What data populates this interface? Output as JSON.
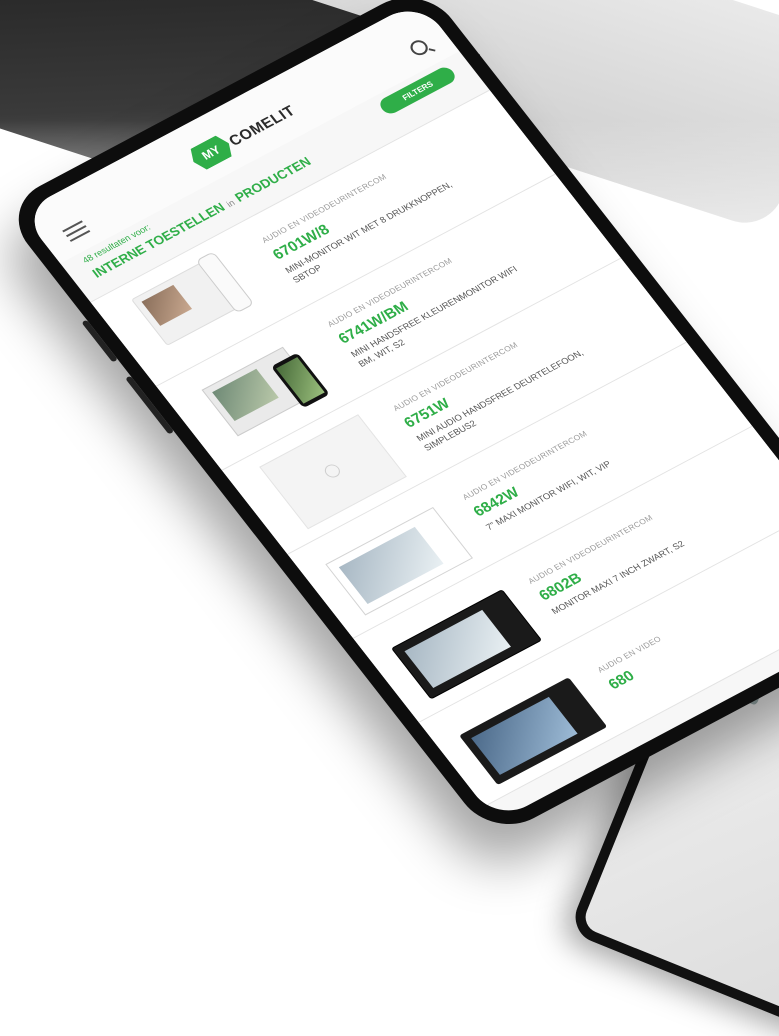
{
  "app": {
    "logo_mark": "MY",
    "logo_text": "COMELIT"
  },
  "results": {
    "count_text": "48 resultaten voor:",
    "query_keyword": "INTERNE TOESTELLEN",
    "query_in": "in",
    "query_scope": "PRODUCTEN",
    "filter_label": "FILTERS"
  },
  "products": [
    {
      "category": "AUDIO EN VIDEODEURINTERCOM",
      "code": "6701W/8",
      "description": "MINI-MONITOR WIT MET 8 DRUKKNOPPEN, SBTOP"
    },
    {
      "category": "AUDIO EN VIDEODEURINTERCOM",
      "code": "6741W/BM",
      "description": "MINI HANDSFREE KLEURENMONITOR WIFI BM, WIT, S2"
    },
    {
      "category": "AUDIO EN VIDEODEURINTERCOM",
      "code": "6751W",
      "description": "MINI AUDIO HANDSFREE DEURTELEFOON, SIMPLEBUS2"
    },
    {
      "category": "AUDIO EN VIDEODEURINTERCOM",
      "code": "6842W",
      "description": "7\" MAXI MONITOR WIFI, WIT, VIP"
    },
    {
      "category": "AUDIO EN VIDEODEURINTERCOM",
      "code": "6802B",
      "description": "MONITOR MAXI 7 INCH ZWART, S2"
    },
    {
      "category": "AUDIO EN VIDEO",
      "code": "680",
      "description": ""
    }
  ]
}
